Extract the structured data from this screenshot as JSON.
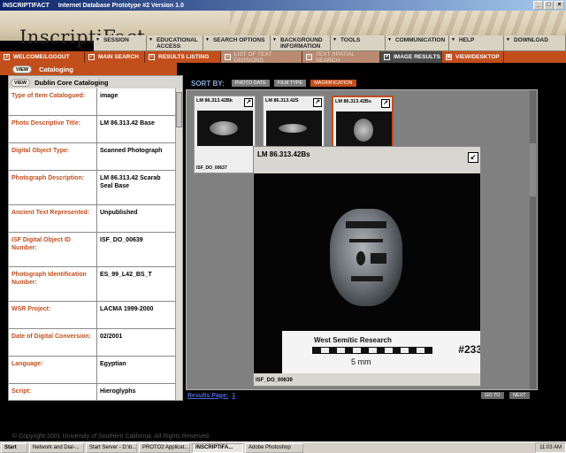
{
  "window": {
    "app": "INSCRIPTIFACT",
    "title": "Internet Database Prototype #2 Version 1.0"
  },
  "header": {
    "logo": "InscriptiFact"
  },
  "main_nav": [
    "SESSION",
    "EDUCATIONAL ACCESS",
    "SEARCH OPTIONS",
    "BACKGROUND INFORMATION",
    "TOOLS",
    "COMMUNICATION",
    "HELP",
    "DOWNLOAD"
  ],
  "sub_nav": [
    "WELCOME/LOGOUT",
    "MAIN SEARCH",
    "RESULTS LISTING",
    "LIST OF TEXT DIVISIONS",
    "TEXT SPATIAL SEARCH",
    "IMAGE RESULTS",
    "VIEW/DESKTOP"
  ],
  "cataloging": {
    "view_label": "VIEW",
    "title": "Cataloging",
    "dc_title": "Dublin Core Cataloging"
  },
  "metadata": [
    {
      "key": "Type of Item Catalogued:",
      "value": "image"
    },
    {
      "key": "Photo Descriptive Title:",
      "value": "LM 86.313.42 Base"
    },
    {
      "key": "Digital Object Type:",
      "value": "Scanned Photograph"
    },
    {
      "key": "Photograph Description:",
      "value": "LM 86.313.42 Scarab Seal Base"
    },
    {
      "key": "Ancient Text Represented:",
      "value": "Unpublished"
    },
    {
      "key": "ISF Digital Object ID Number:",
      "value": "ISF_DO_00639"
    },
    {
      "key": "Photograph Identification Number:",
      "value": "ES_99_L42_BS_T"
    },
    {
      "key": "WSR Project:",
      "value": "LACMA 1999-2000"
    },
    {
      "key": "Date of Digital Conversion:",
      "value": "02/2001"
    },
    {
      "key": "Language:",
      "value": "Egyptian"
    },
    {
      "key": "Script:",
      "value": "Hieroglyphs"
    }
  ],
  "sort": {
    "label": "SORT BY:",
    "options": [
      "PHOTO DATE",
      "FILM TYPE",
      "MAGNIFICATION"
    ]
  },
  "thumbnails": [
    {
      "caption": "LM 86.313.42Bk",
      "filename": "ISF_DO_00637"
    },
    {
      "caption": "LM 86.313.42S",
      "filename": ""
    },
    {
      "caption": "LM 86.313.42Bs",
      "filename": ""
    }
  ],
  "viewer": {
    "title": "LM 86.313.42Bs",
    "filename": "ISF_DO_00639",
    "ruler_text": "West Semitic Research",
    "ruler_scale": "5 mm",
    "ruler_number": "#233"
  },
  "results_page": {
    "label": "Results Page:",
    "page": "1",
    "goto": "GO TO",
    "next": "NEXT"
  },
  "copyright": "© Copyright 2001 University of Southern California. All Rights Reserved.",
  "taskbar": {
    "start": "Start",
    "items": [
      "Network and Dial-...",
      "Start Server - D:\\b...",
      "PROTO2 Applicat...",
      "INSCRIPTIFA...",
      "Adobe Photoshop"
    ],
    "clock": "11:03 AM"
  }
}
